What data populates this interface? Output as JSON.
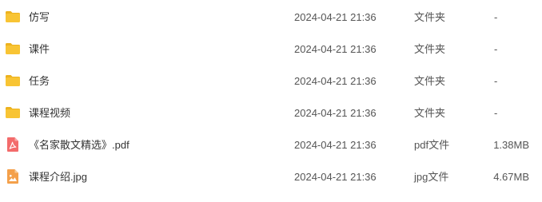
{
  "colors": {
    "folder": "#F8C434",
    "folder_tab": "#EDB21F",
    "pdf": "#F36B6B",
    "image": "#F4A04A"
  },
  "files": [
    {
      "icon": "folder-icon",
      "name": "仿写",
      "modified": "2024-04-21 21:36",
      "type": "文件夹",
      "size": "-"
    },
    {
      "icon": "folder-icon",
      "name": "课件",
      "modified": "2024-04-21 21:36",
      "type": "文件夹",
      "size": "-"
    },
    {
      "icon": "folder-icon",
      "name": "任务",
      "modified": "2024-04-21 21:36",
      "type": "文件夹",
      "size": "-"
    },
    {
      "icon": "folder-icon",
      "name": "课程视频",
      "modified": "2024-04-21 21:36",
      "type": "文件夹",
      "size": "-"
    },
    {
      "icon": "pdf-file-icon",
      "name": "《名家散文精选》.pdf",
      "modified": "2024-04-21 21:36",
      "type": "pdf文件",
      "size": "1.38MB"
    },
    {
      "icon": "image-file-icon",
      "name": "课程介绍.jpg",
      "modified": "2024-04-21 21:36",
      "type": "jpg文件",
      "size": "4.67MB"
    }
  ]
}
